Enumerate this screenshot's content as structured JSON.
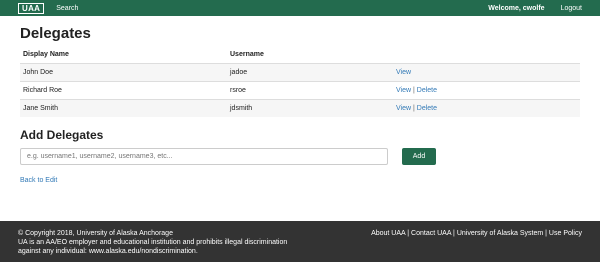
{
  "nav": {
    "logo": "UAA",
    "search": "Search",
    "welcome": "Welcome, cwolfe",
    "logout": "Logout"
  },
  "main": {
    "title": "Delegates",
    "columns": [
      "Display Name",
      "Username"
    ],
    "rows": [
      {
        "display_name": "John Doe",
        "username": "jadoe",
        "actions": [
          "View"
        ]
      },
      {
        "display_name": "Richard Roe",
        "username": "rsroe",
        "actions": [
          "View",
          "Delete"
        ]
      },
      {
        "display_name": "Jane Smith",
        "username": "jdsmith",
        "actions": [
          "View",
          "Delete"
        ]
      }
    ],
    "action_separator": "|"
  },
  "add": {
    "title": "Add Delegates",
    "placeholder": "e.g. username1, username2, username3, etc...",
    "button": "Add",
    "back_link": "Back to Edit"
  },
  "footer": {
    "copyright": "© Copyright 2018, University of Alaska Anchorage",
    "line2": "UA is an AA/EO employer and educational institution and prohibits illegal discrimination",
    "line3": "against any individual: www.alaska.edu/nondiscrimination.",
    "links": [
      "About UAA",
      "Contact UAA",
      "University of Alaska System",
      "Use Policy"
    ],
    "link_separator": " | "
  },
  "colors": {
    "nav_bg": "#236b4e",
    "link": "#337ab7",
    "footer_bg": "#333333"
  }
}
